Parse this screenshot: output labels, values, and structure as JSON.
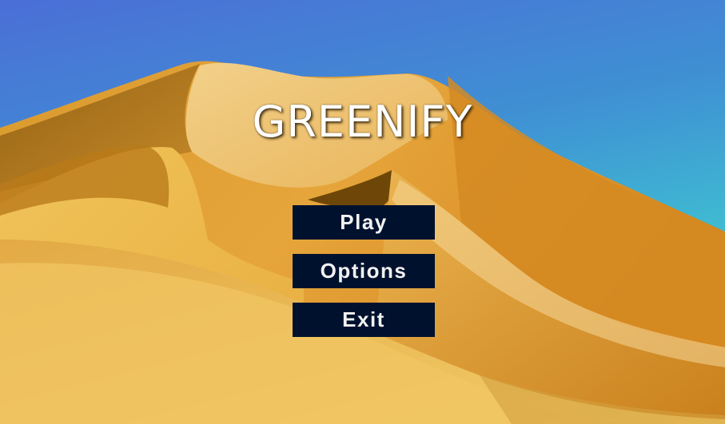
{
  "game": {
    "title": "GREENIFY"
  },
  "menu": {
    "items": [
      {
        "label": "Play"
      },
      {
        "label": "Options"
      },
      {
        "label": "Exit"
      }
    ]
  },
  "colors": {
    "sky_top": "#4a74d6",
    "sky_bottom": "#3fd3d4",
    "sand": "#e8a93a",
    "button_bg": "#00112e",
    "button_text": "#f2f2f2",
    "title_text": "#ffffff"
  }
}
